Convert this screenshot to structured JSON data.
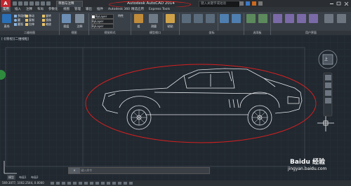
{
  "app_title": "Autodesk AutoCAD 2014    Drawing1.dwg",
  "workspace": "草图与注释",
  "search_placeholder": "键入关键字或短语",
  "tabs": [
    "常用",
    "插入",
    "注释",
    "布局",
    "参数化",
    "视图",
    "管理",
    "输出",
    "插件",
    "Autodesk 360",
    "精选应用",
    "Express Tools"
  ],
  "active_tab": 0,
  "ribbon": {
    "draw_label": "绘图",
    "modify_label": "修改",
    "layer_label": "图层",
    "annot_label": "注释",
    "block_label": "块",
    "props_label": "特性",
    "groups_label": "组",
    "utils_label": "实用工具",
    "clipboard_label": "剪贴板",
    "view_label": "视图",
    "draw_tools": [
      "直线",
      "多段线",
      "圆",
      "圆弧"
    ],
    "modify_tools": [
      "移动",
      "复制",
      "拉伸",
      "旋转",
      "镜像",
      "缩放"
    ],
    "group_tools": [
      "组",
      "解除编组"
    ],
    "utils_tools": [
      "测量"
    ],
    "clip_tools": [
      "粘贴"
    ],
    "bylayer": "ByLayer",
    "panel_titles": [
      "二维绘图",
      "视图",
      "视觉样式",
      "模型视口",
      "坐标",
      "选项板",
      "用户界面"
    ]
  },
  "viewport_label": "[-][俯视][二维线框]",
  "command_prompt": "键入命令",
  "status_coords": "569.3077, 1002.2544, 0.0000",
  "model_tabs": [
    "模型",
    "布局1",
    "布局2"
  ],
  "viewcube_label": "上",
  "watermark": "Baidu 经验",
  "watermark_url": "jingyan.baidu.com",
  "colors": {
    "accent": "#c4262e",
    "highlight": "#e02020"
  }
}
